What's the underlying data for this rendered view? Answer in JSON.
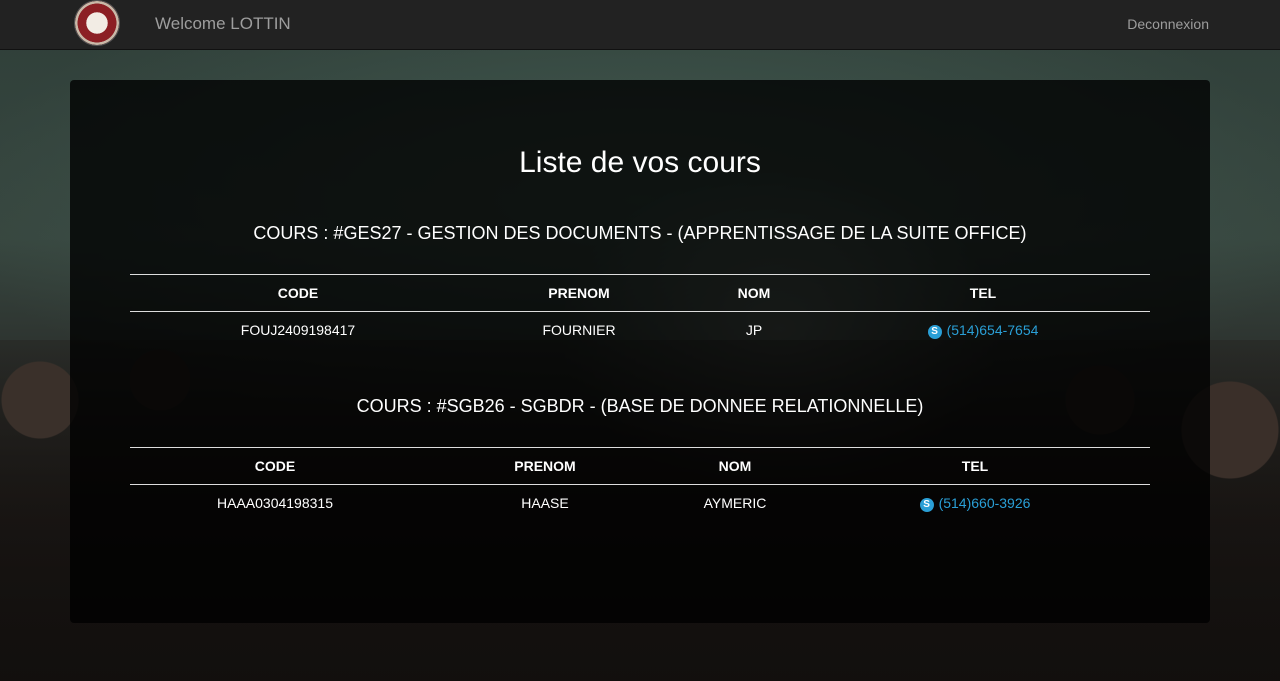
{
  "navbar": {
    "welcome": "Welcome LOTTIN",
    "logout": "Deconnexion",
    "logo_icon": "college-crest-logo"
  },
  "main": {
    "title": "Liste de vos cours",
    "courses": [
      {
        "heading": "COURS : #GES27 - GESTION DES DOCUMENTS - (APPRENTISSAGE DE LA SUITE OFFICE)",
        "columns": [
          "CODE",
          "PRENOM",
          "NOM",
          "TEL"
        ],
        "rows": [
          {
            "code": "FOUJ2409198417",
            "prenom": "FOURNIER",
            "nom": "JP",
            "tel": "(514)654-7654"
          }
        ]
      },
      {
        "heading": "COURS : #SGB26 - SGBDR - (BASE DE DONNEE RELATIONNELLE)",
        "columns": [
          "CODE",
          "PRENOM",
          "NOM",
          "TEL"
        ],
        "rows": [
          {
            "code": "HAAA0304198315",
            "prenom": "HAASE",
            "nom": "AYMERIC",
            "tel": "(514)660-3926"
          }
        ]
      }
    ]
  },
  "icons": {
    "tel": "skype-icon"
  },
  "colors": {
    "link": "#2a9fd6",
    "navbar": "#222222"
  }
}
